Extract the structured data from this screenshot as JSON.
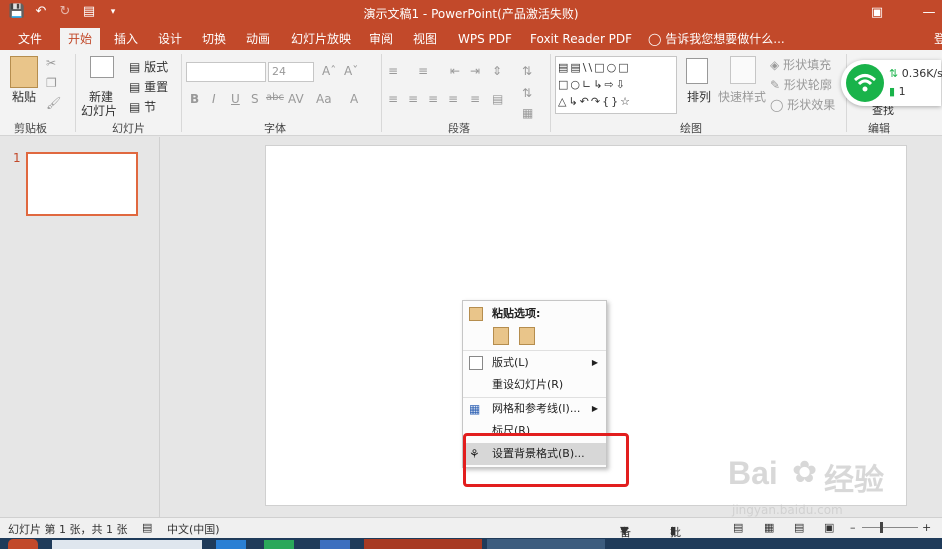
{
  "title": "演示文稿1 - PowerPoint(产品激活失败)",
  "tabs": [
    {
      "label": "文件"
    },
    {
      "label": "开始"
    },
    {
      "label": "插入"
    },
    {
      "label": "设计"
    },
    {
      "label": "切换"
    },
    {
      "label": "动画"
    },
    {
      "label": "幻灯片放映"
    },
    {
      "label": "审阅"
    },
    {
      "label": "视图"
    },
    {
      "label": "WPS PDF"
    },
    {
      "label": "Foxit Reader PDF"
    },
    {
      "label": "告诉我您想要做什么..."
    },
    {
      "label": "登"
    }
  ],
  "ribbon": {
    "clipboard": {
      "paste": "粘贴",
      "label": "剪贴板"
    },
    "slides": {
      "new_slide_1": "新建",
      "new_slide_2": "幻灯片",
      "layout": "版式",
      "reset": "重置",
      "section": "节",
      "label": "幻灯片"
    },
    "font": {
      "size": "24",
      "bold": "B",
      "italic": "I",
      "underline": "U",
      "shadow": "S",
      "strike": "abc",
      "spacing": "AV",
      "case": "Aa",
      "label": "字体"
    },
    "paragraph": {
      "label": "段落"
    },
    "drawing": {
      "arrange": "排列",
      "quick_styles": "快速样式",
      "shape_fill": "形状填充",
      "shape_outline": "形状轮廓",
      "shape_effects": "形状效果",
      "label": "绘图"
    },
    "editing": {
      "label": "编辑",
      "find": "查找"
    }
  },
  "slide_pane": {
    "number": "1"
  },
  "context_menu": {
    "paste_options": "粘贴选项:",
    "layout": "版式(L)",
    "reset_slide": "重设幻灯片(R)",
    "grid_guides": "网格和参考线(I)...",
    "ruler": "标尺(R)",
    "format_background": "设置背景格式(B)..."
  },
  "status": {
    "slide_info": "幻灯片 第 1 张，共 1 张",
    "language": "中文(中国)",
    "notes": "备注",
    "comments": "批注"
  },
  "network": {
    "speed": "0.36K/s",
    "count": "1"
  },
  "watermark": {
    "brand": "Bai",
    "brand_cn": "经验",
    "url": "jingyan.baidu.com"
  },
  "colors": {
    "accent": "#c2492a",
    "highlight_box": "#e21e1e",
    "wifi": "#19b34a"
  }
}
